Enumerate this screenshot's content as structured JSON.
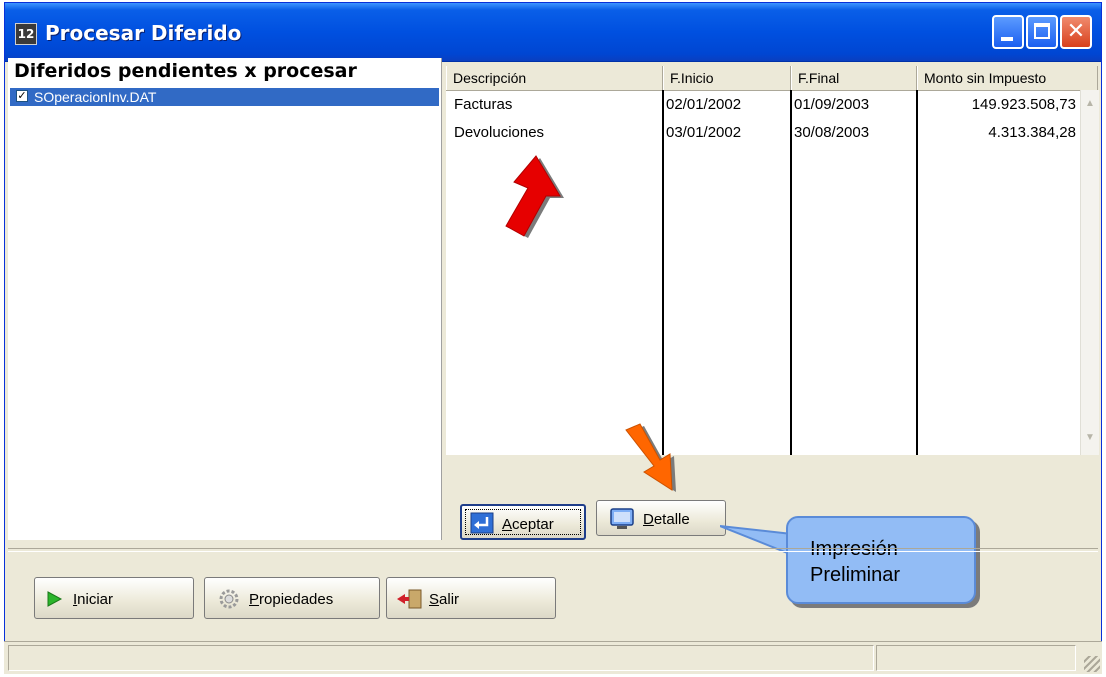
{
  "window": {
    "title": "Procesar Diferido",
    "icon": "app-icon"
  },
  "left_panel": {
    "header": "Diferidos pendientes x procesar",
    "items": [
      {
        "label": "SOperacionInv.DAT",
        "checked": true,
        "selected": true
      }
    ]
  },
  "grid": {
    "columns": [
      "Descripción",
      "F.Inicio",
      "F.Final",
      "Monto sin Impuesto"
    ],
    "rows": [
      [
        "Facturas",
        "02/01/2002",
        "01/09/2003",
        "149.923.508,73"
      ],
      [
        "Devoluciones",
        "03/01/2002",
        "30/08/2003",
        "4.313.384,28"
      ]
    ]
  },
  "buttons": {
    "aceptar": {
      "label": "Aceptar",
      "underline": "A",
      "rest": "ceptar",
      "icon": "enter-icon"
    },
    "detalle": {
      "label": "Detalle",
      "underline": "D",
      "rest": "etalle",
      "icon": "monitor-icon"
    },
    "iniciar": {
      "label": "Iniciar",
      "underline": "I",
      "rest": "niciar",
      "icon": "play-icon"
    },
    "propiedades": {
      "label": "Propiedades",
      "underline": "P",
      "rest": "ropiedades",
      "icon": "gear-icon"
    },
    "salir": {
      "label": "Salir",
      "underline": "S",
      "rest": "alir",
      "icon": "exit-icon"
    }
  },
  "callout": {
    "line1": "Impresión",
    "line2": "Preliminar"
  },
  "colors": {
    "titlebar": "#0050e0",
    "selection": "#316ac5",
    "callout_bg": "#92bcf5",
    "arrow_red": "#e60000",
    "arrow_orange": "#ff6600"
  }
}
